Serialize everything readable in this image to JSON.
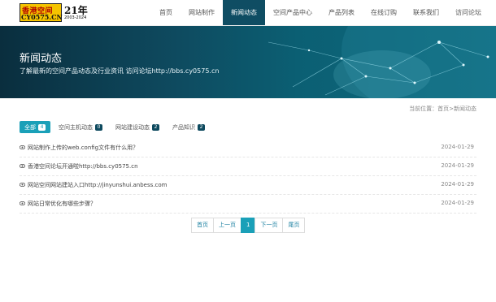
{
  "logo": {
    "top_text": "香港空间",
    "bottom_text": "CY0575.CN",
    "big": "21年",
    "years": "2003-2024"
  },
  "nav": [
    {
      "label": "首页",
      "active": false
    },
    {
      "label": "网站制作",
      "active": false
    },
    {
      "label": "新闻动态",
      "active": true
    },
    {
      "label": "空间产品中心",
      "active": false
    },
    {
      "label": "产品列表",
      "active": false
    },
    {
      "label": "在线订购",
      "active": false
    },
    {
      "label": "联系我们",
      "active": false
    },
    {
      "label": "访问论坛",
      "active": false
    }
  ],
  "banner": {
    "title": "新闻动态",
    "subtitle": "了解最新的空间产品动态及行业资讯 访问论坛http://bbs.cy0575.cn"
  },
  "breadcrumb": "当前位置：首页>新闻动态",
  "tabs": [
    {
      "label": "全部",
      "count": "4",
      "active": true
    },
    {
      "label": "空间主机动态",
      "count": "0",
      "active": false
    },
    {
      "label": "网站建设动态",
      "count": "2",
      "active": false
    },
    {
      "label": "产品知识",
      "count": "2",
      "active": false
    }
  ],
  "articles": [
    {
      "title": "网站制作上传的web.config文件有什么用？",
      "date": "2024-01-29"
    },
    {
      "title": "香港空间论坛开通啦http://bbs.cy0575.cn",
      "date": "2024-01-29"
    },
    {
      "title": "网站空间网站建站入口http://jinyunshui.anbess.com",
      "date": "2024-01-29"
    },
    {
      "title": "网站日常优化有哪些步骤？",
      "date": "2024-01-29"
    }
  ],
  "pagination": [
    {
      "label": "首页",
      "active": false
    },
    {
      "label": "上一页",
      "active": false
    },
    {
      "label": "1",
      "active": true
    },
    {
      "label": "下一页",
      "active": false
    },
    {
      "label": "尾页",
      "active": false
    }
  ],
  "colors": {
    "accent": "#1aa0b8",
    "nav_active": "#0f4d63",
    "banner": "#0e4a5f"
  }
}
